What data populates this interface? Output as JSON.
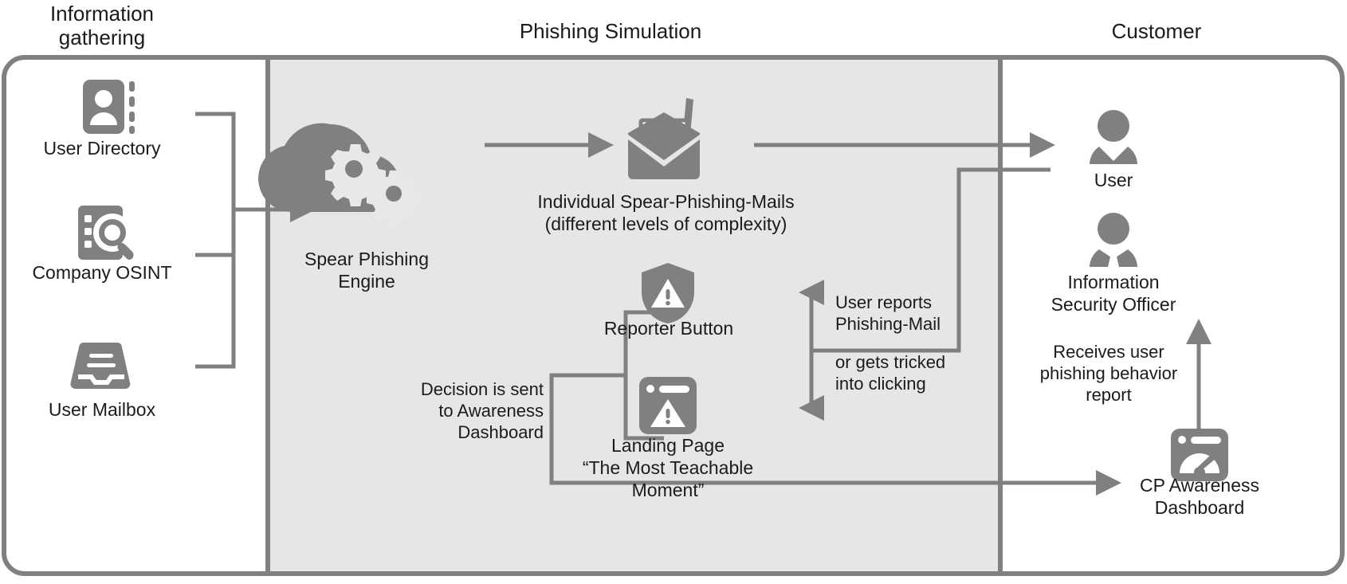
{
  "columns": [
    {
      "id": "information-gathering",
      "title": "Information\ngathering"
    },
    {
      "id": "phishing-simulation",
      "title": "Phishing Simulation"
    },
    {
      "id": "customer",
      "title": "Customer"
    }
  ],
  "nodes": [
    {
      "id": "user-directory",
      "icon": "contact-card-icon",
      "label": "User Directory"
    },
    {
      "id": "company-osint",
      "icon": "document-search-icon",
      "label": "Company OSINT"
    },
    {
      "id": "user-mailbox",
      "icon": "inbox-tray-icon",
      "label": "User Mailbox"
    },
    {
      "id": "spear-phishing-engine",
      "icon": "cloud-gears-icon",
      "label": "Spear Phishing\nEngine"
    },
    {
      "id": "spear-phishing-mails",
      "icon": "envelope-letter-icon",
      "label": "Individual Spear-Phishing-Mails\n(different levels of complexity)"
    },
    {
      "id": "reporter-button",
      "icon": "shield-warning-icon",
      "label": "Reporter Button"
    },
    {
      "id": "landing-page",
      "icon": "browser-warning-icon",
      "label": "Landing Page\n“The Most Teachable Moment”"
    },
    {
      "id": "user",
      "icon": "person-icon",
      "label": "User"
    },
    {
      "id": "information-security-officer",
      "icon": "person-suit-icon",
      "label": "Information\nSecurity Officer"
    },
    {
      "id": "cp-awareness-dashboard",
      "icon": "browser-gauge-icon",
      "label": "CP Awareness\nDashboard"
    }
  ],
  "edge_labels": [
    {
      "id": "user-reports-phishing-mail",
      "text": "User reports\nPhishing-Mail"
    },
    {
      "id": "or-gets-tricked-into-clicking",
      "text": "or gets tricked\ninto clicking"
    },
    {
      "id": "decision-is-sent-to-awareness-dashboard",
      "text": "Decision is sent\nto Awareness\nDashboard"
    },
    {
      "id": "receives-user-phishing-behavior-report",
      "text": "Receives user\nphishing behavior\nreport"
    }
  ],
  "colors": {
    "icon_fill": "#808080",
    "line": "#808080",
    "panel_background": "#e6e6e6",
    "canvas_background": "#ffffff",
    "text": "#1b1b1b",
    "border": "#808080"
  }
}
